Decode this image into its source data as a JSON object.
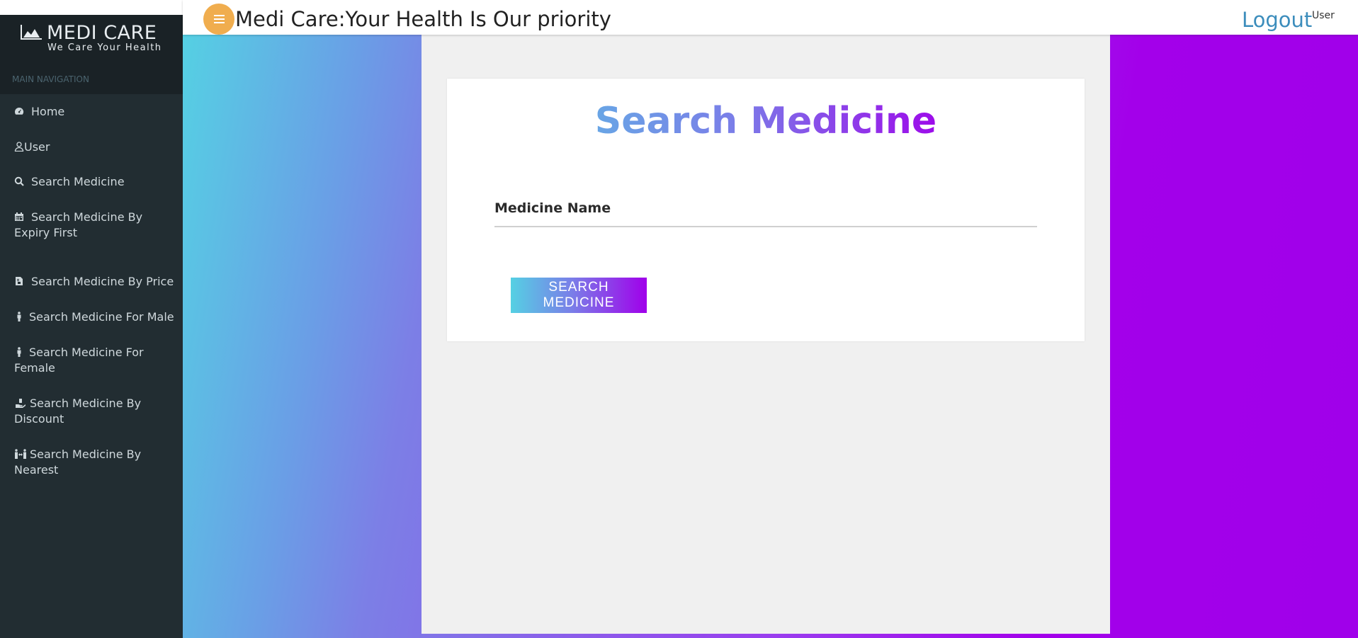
{
  "brand": {
    "title": "MEDI CARE",
    "subtitle": "We Care Your Health"
  },
  "nav": {
    "header": "MAIN NAVIGATION",
    "items": [
      {
        "label": "Home",
        "icon": "dashboard-icon"
      },
      {
        "label": "User",
        "icon": "user-icon"
      },
      {
        "label": "Search Medicine",
        "icon": "search-icon"
      },
      {
        "label": "Search Medicine By Expiry First",
        "icon": "calendar-icon"
      },
      {
        "label": "Search Medicine By Price",
        "icon": "file-invoice-icon"
      },
      {
        "label": "Search Medicine For Male",
        "icon": "male-icon"
      },
      {
        "label": "Search Medicine For Female",
        "icon": "female-icon"
      },
      {
        "label": "Search Medicine By Discount",
        "icon": "hand-holding-icon"
      },
      {
        "label": "Search Medicine By Nearest",
        "icon": "people-arrows-icon"
      }
    ]
  },
  "topbar": {
    "title": "Medi Care:Your Health Is Our priority",
    "logout": "Logout",
    "user": "User"
  },
  "form": {
    "title_part1": "Search",
    "title_part2": "Medicine",
    "field_label": "Medicine Name",
    "field_value": "",
    "button": "SEARCH MEDICINE"
  },
  "colors": {
    "sidebar_bg": "#222d32",
    "menu_button": "#f0ad4e",
    "logout_link": "#3c8dbc",
    "gradient_start": "#55d0e3",
    "gradient_end": "#a000ea"
  }
}
